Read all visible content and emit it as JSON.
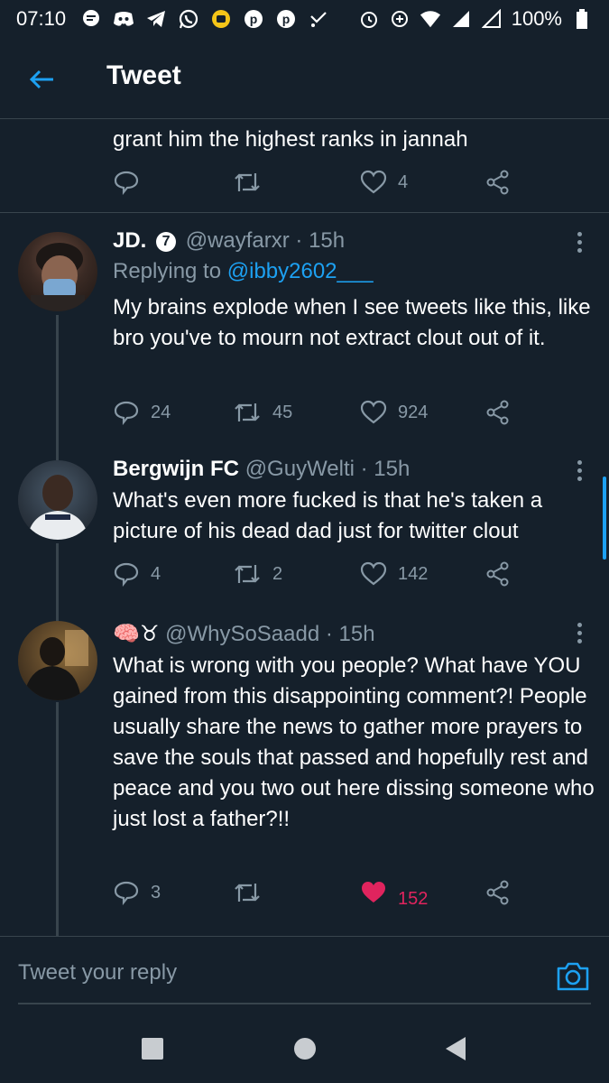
{
  "status_bar": {
    "time": "07:10",
    "battery": "100%",
    "icons": [
      "message-bubble-icon",
      "discord-icon",
      "telegram-icon",
      "whatsapp-icon",
      "app-icon",
      "pinterest-icon",
      "pinterest-icon",
      "missed-call-icon"
    ],
    "right_icons": [
      "alarm-icon",
      "data-saver-icon",
      "wifi-icon",
      "signal-icon",
      "signal-icon",
      "battery-icon"
    ]
  },
  "header": {
    "title": "Tweet"
  },
  "partial_tweet": {
    "text": "grant him the highest ranks in jannah",
    "like_count": "4"
  },
  "replies": [
    {
      "name": "JD.",
      "badge": "7",
      "handle": "@wayfarxr",
      "time": "· 15h",
      "replying_label": "Replying to",
      "replying_to": "@ibby2602___",
      "text": "My brains explode when I see tweets like this, like bro you've to mourn not extract clout out of it.",
      "reply_count": "24",
      "retweet_count": "45",
      "like_count": "924"
    },
    {
      "name": "Bergwijn FC",
      "handle": "@GuyWelti",
      "time": "· 15h",
      "text": "What's even more fucked is that he's taken a picture of his dead dad just for twitter clout",
      "reply_count": "4",
      "retweet_count": "2",
      "like_count": "142"
    },
    {
      "name": "🧠♉",
      "handle": "@WhySoSaadd",
      "time": "· 15h",
      "text": "What is wrong with you people? What have YOU gained from this disappointing comment?! People usually share the news to gather more prayers to save the souls that passed and hopefully rest and peace and you two out here dissing someone who just lost a father?!!",
      "reply_count": "3",
      "like_count": "152",
      "liked": true
    }
  ],
  "compose": {
    "placeholder": "Tweet your reply"
  },
  "colors": {
    "background": "#15202b",
    "accent": "#1da1f2",
    "muted": "#8899a6",
    "like": "#e0245e",
    "divider": "#38444d"
  }
}
